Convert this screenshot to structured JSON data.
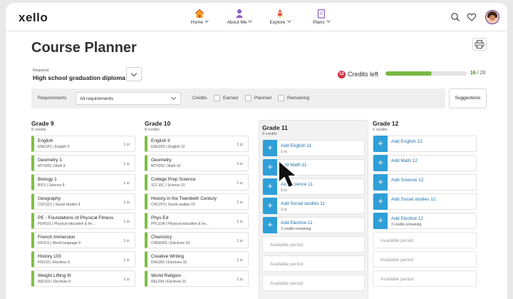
{
  "app": {
    "logo": "xello"
  },
  "nav": [
    {
      "label": "Home",
      "icon": "home-icon"
    },
    {
      "label": "About Me",
      "icon": "person-icon"
    },
    {
      "label": "Explore",
      "icon": "rocket-icon"
    },
    {
      "label": "Plans",
      "icon": "clipboard-icon"
    }
  ],
  "page": {
    "title": "Course Planner",
    "requirement_label": "Required",
    "requirement_value": "High school graduation diploma"
  },
  "credits": {
    "badge": "12",
    "label": "Credits left",
    "progress_fraction": 0.57,
    "earned": "16",
    "total": "/ 28"
  },
  "filters": {
    "requirements_label": "Requirements",
    "requirements_value": "All requirements",
    "credits_label": "Credits",
    "earned": "Earned",
    "planned": "Planned",
    "remaining": "Remaining",
    "suggestions": "Suggestions"
  },
  "grades": {
    "g9": {
      "title": "Grade 9",
      "credits": "8 credits",
      "courses": [
        {
          "name": "English",
          "code": "ENG1P1  |  English 9",
          "cr": "1 cr."
        },
        {
          "name": "Geometry 1",
          "code": "MTH201  |  Math 9",
          "cr": "1 cr."
        },
        {
          "name": "Biology 1",
          "code": "BIO1  |  Science 9",
          "cr": "1 cr."
        },
        {
          "name": "Geography",
          "code": "CGC1D1  |  Social studies 9",
          "cr": "1 cr."
        },
        {
          "name": "PE - Foundations of Physical Fitness",
          "code": "PEH101  |  Physical education & he...",
          "cr": "1 cr."
        },
        {
          "name": "French Immersion",
          "code": "FIF1D1  |  World language 9",
          "cr": "1 cr."
        },
        {
          "name": "History 103",
          "code": "HIS103  |  Electives 9",
          "cr": "1 cr."
        },
        {
          "name": "Weight Lifting III",
          "code": "WEI103  |  Electives 9",
          "cr": "1 cr."
        }
      ]
    },
    "g10": {
      "title": "Grade 10",
      "credits": "8 credits",
      "courses": [
        {
          "name": "English II",
          "code": "ENG2D1  |  English 10",
          "cr": "1 cr."
        },
        {
          "name": "Geometry",
          "code": "MTH202  |  Math 10",
          "cr": "1 cr."
        },
        {
          "name": "College Prep Science",
          "code": "SCI 10C  |  Science 10",
          "cr": "1 cr."
        },
        {
          "name": "History in the Twentieth Century",
          "code": "CHC2P3  |  Social studies 10",
          "cr": "1 cr."
        },
        {
          "name": "Phys Ed",
          "code": "PPL1OA  |  Physical education & he...",
          "cr": "1 cr."
        },
        {
          "name": "Chemistry",
          "code": "CHEM201  |  Electives 10",
          "cr": "1 cr."
        },
        {
          "name": "Creative Writing",
          "code": "ENG302  |  Electives 10",
          "cr": "1 cr."
        },
        {
          "name": "World Religion",
          "code": "REL234  |  Electives 10",
          "cr": "1 cr."
        }
      ]
    },
    "g11": {
      "title": "Grade 11",
      "credits": "0 credits",
      "slots": [
        {
          "name": "Add English 11",
          "sub": "1 cr."
        },
        {
          "name": "Add Math 11",
          "sub": ""
        },
        {
          "name": "Add Science 11",
          "sub": "1 cr."
        },
        {
          "name": "Add Social studies 11",
          "sub": "1 cr."
        },
        {
          "name": "Add Elective 11",
          "sub": "3 credits remaining"
        }
      ],
      "available": [
        "Available period",
        "Available period",
        "Available period"
      ]
    },
    "g12": {
      "title": "Grade 12",
      "credits": "0 credits",
      "slots": [
        {
          "name": "Add English 12",
          "sub": ""
        },
        {
          "name": "Add Math 12",
          "sub": ""
        },
        {
          "name": "Add Science 12",
          "sub": ""
        },
        {
          "name": "Add Social studies 12",
          "sub": ""
        },
        {
          "name": "Add Elective 12",
          "sub": "3 credits remaining"
        }
      ],
      "available": [
        "Available period",
        "Available period",
        "Available period"
      ]
    }
  },
  "colors": {
    "accent_blue": "#2f9fd8",
    "green": "#7dbf43",
    "badge_red": "#d2343f"
  }
}
